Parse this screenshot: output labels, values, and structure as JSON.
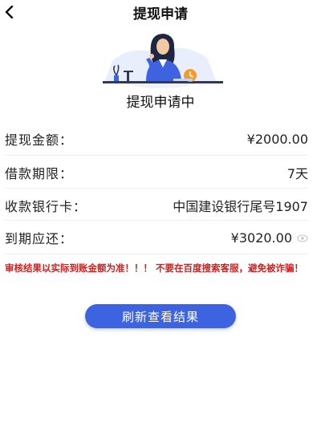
{
  "header": {
    "title": "提现申请"
  },
  "status": {
    "text": "提现申请中"
  },
  "rows": [
    {
      "label": "提现金额：",
      "value": "¥2000.00"
    },
    {
      "label": "借款期限：",
      "value": "7天"
    },
    {
      "label": "收款银行卡：",
      "value": "中国建设银行尾号1907"
    },
    {
      "label": "到期应还：",
      "value": "¥3020.00"
    }
  ],
  "warning": "审核结果以实际到账金额为准！！！ 不要在百度搜索客服，避免被诈骗！",
  "button": {
    "label": "刷新查看结果"
  },
  "colors": {
    "accent": "#3d63e0",
    "warning": "#d0201f"
  }
}
